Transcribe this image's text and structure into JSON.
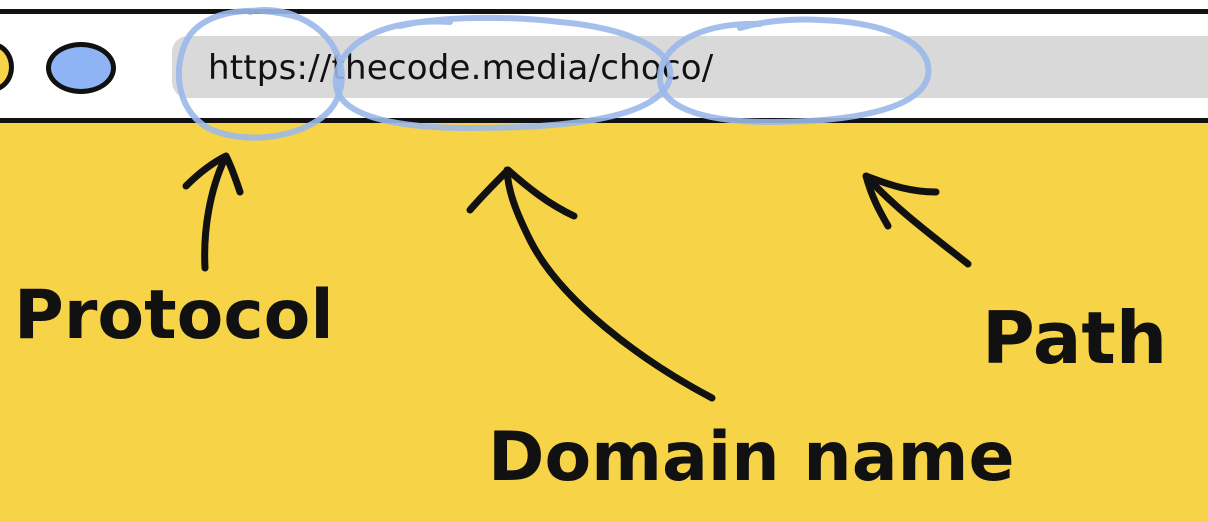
{
  "colors": {
    "background": "#f7d347",
    "address_bar": "#d9d9d9",
    "circle_highlight": "#9bb8ea",
    "blue_dot": "#8fb4f5",
    "yellow_dot": "#f7d347",
    "ink": "#111111"
  },
  "browser": {
    "url_parts": {
      "protocol": "https:",
      "separator": "/",
      "domain": "/thecode.media",
      "path": "/choco/"
    }
  },
  "labels": {
    "protocol": "Protocol",
    "domain": "Domain name",
    "path": "Path"
  },
  "icons": [
    "arrow-up-protocol",
    "arrow-up-domain",
    "arrow-up-path"
  ]
}
